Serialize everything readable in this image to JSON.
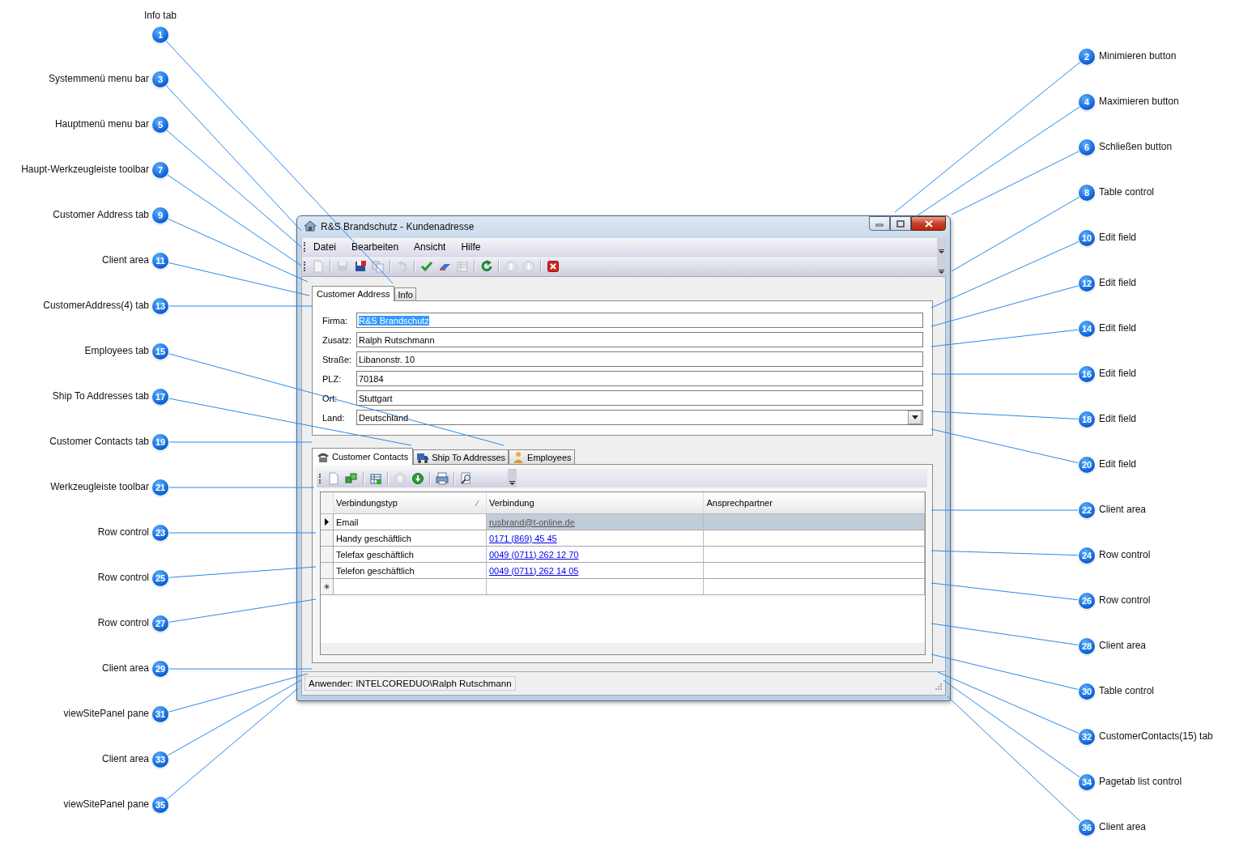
{
  "window": {
    "title": "R&S Brandschutz - Kundenadresse"
  },
  "menu": [
    "Datei",
    "Bearbeiten",
    "Ansicht",
    "Hilfe"
  ],
  "main_tabs": [
    {
      "label": "Customer Address",
      "selected": true
    },
    {
      "label": "Info",
      "selected": false
    }
  ],
  "form": [
    {
      "label": "Firma:",
      "value": "R&S Brandschutz",
      "kind": "text",
      "text_selected": true
    },
    {
      "label": "Zusatz:",
      "value": "Ralph Rutschmann",
      "kind": "text",
      "text_selected": false
    },
    {
      "label": "Straße:",
      "value": "Libanonstr. 10",
      "kind": "text",
      "text_selected": false
    },
    {
      "label": "PLZ:",
      "value": "70184",
      "kind": "text",
      "text_selected": false
    },
    {
      "label": "Ort:",
      "value": "Stuttgart",
      "kind": "text",
      "text_selected": false
    },
    {
      "label": "Land:",
      "value": "Deutschland",
      "kind": "dropdown",
      "text_selected": false
    }
  ],
  "contact_tabs": [
    {
      "label": "Customer Contacts",
      "kind": "phone",
      "selected": true
    },
    {
      "label": "Ship To Addresses",
      "kind": "truck",
      "selected": false
    },
    {
      "label": "Employees",
      "kind": "person",
      "selected": false
    }
  ],
  "grid": {
    "columns": [
      "Verbindungstyp",
      "Verbindung",
      "Ansprechpartner"
    ],
    "rows": [
      {
        "kind": "data",
        "type": "Email",
        "connection": "rusbrand@t-online.de",
        "selected": true
      },
      {
        "kind": "data",
        "type": "Handy geschäftlich",
        "connection": "0171 (869) 45 45",
        "selected": false
      },
      {
        "kind": "data",
        "type": "Telefax geschäftlich",
        "connection": "0049 (0711) 262 12 70",
        "selected": false
      },
      {
        "kind": "data",
        "type": "Telefon geschäftlich",
        "connection": "0049 (0711) 262 14 05",
        "selected": false
      },
      {
        "kind": "new",
        "selected": false
      }
    ]
  },
  "status_bar": {
    "text": "Anwender: INTELCOREDUO\\Ralph Rutschmann"
  },
  "callouts": [
    {
      "number": "1",
      "label": "Info tab"
    },
    {
      "number": "2",
      "label": "Minimieren button"
    },
    {
      "number": "3",
      "label": "Systemmenü menu bar"
    },
    {
      "number": "4",
      "label": "Maximieren button"
    },
    {
      "number": "5",
      "label": "Hauptmenü menu bar"
    },
    {
      "number": "6",
      "label": "Schließen button"
    },
    {
      "number": "7",
      "label": "Haupt-Werkzeugleiste toolbar"
    },
    {
      "number": "8",
      "label": "Table control"
    },
    {
      "number": "9",
      "label": "Customer Address tab"
    },
    {
      "number": "10",
      "label": "Edit field"
    },
    {
      "number": "11",
      "label": "Client area"
    },
    {
      "number": "12",
      "label": "Edit field"
    },
    {
      "number": "13",
      "label": "CustomerAddress(4) tab"
    },
    {
      "number": "14",
      "label": "Edit field"
    },
    {
      "number": "15",
      "label": "Employees tab"
    },
    {
      "number": "16",
      "label": "Edit field"
    },
    {
      "number": "17",
      "label": "Ship To Addresses tab"
    },
    {
      "number": "18",
      "label": "Edit field"
    },
    {
      "number": "19",
      "label": "Customer Contacts tab"
    },
    {
      "number": "20",
      "label": "Edit field"
    },
    {
      "number": "21",
      "label": "Werkzeugleiste toolbar"
    },
    {
      "number": "22",
      "label": "Client area"
    },
    {
      "number": "23",
      "label": "Row control"
    },
    {
      "number": "24",
      "label": "Row control"
    },
    {
      "number": "25",
      "label": "Row control"
    },
    {
      "number": "26",
      "label": "Row control"
    },
    {
      "number": "27",
      "label": "Row control"
    },
    {
      "number": "28",
      "label": "Client area"
    },
    {
      "number": "29",
      "label": "Client area"
    },
    {
      "number": "30",
      "label": "Table control"
    },
    {
      "number": "31",
      "label": "viewSitePanel pane"
    },
    {
      "number": "32",
      "label": "CustomerContacts(15) tab"
    },
    {
      "number": "33",
      "label": "Client area"
    },
    {
      "number": "34",
      "label": "Pagetab list control"
    },
    {
      "number": "35",
      "label": "viewSitePanel pane"
    },
    {
      "number": "36",
      "label": "Client area"
    }
  ]
}
